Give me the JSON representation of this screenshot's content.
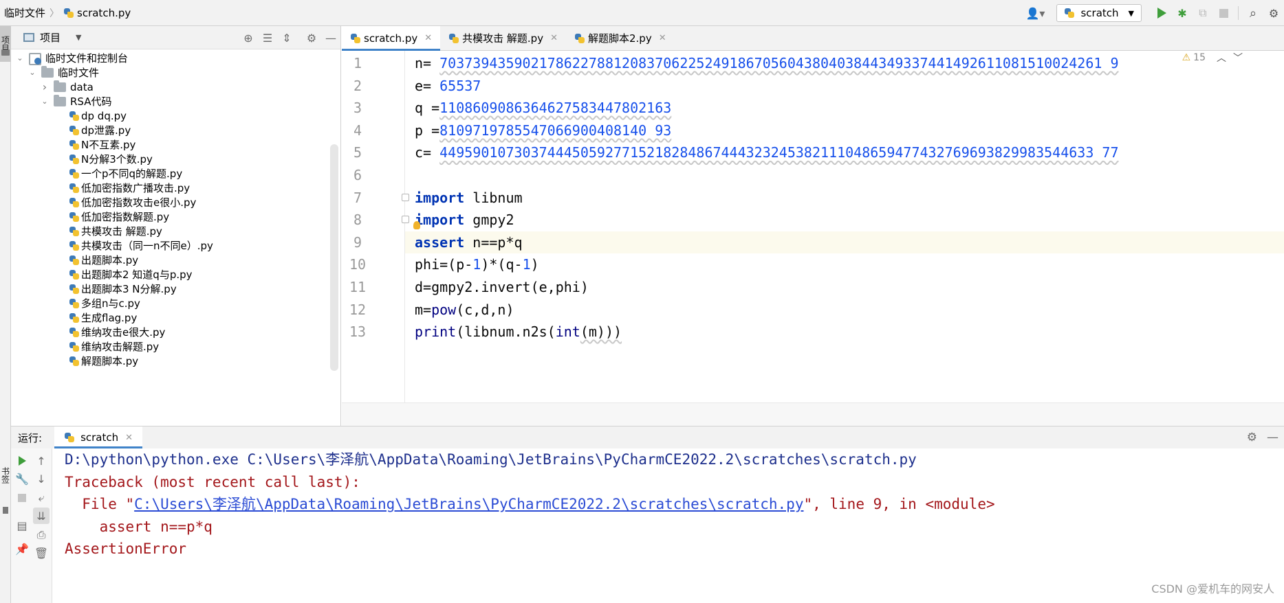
{
  "breadcrumb": {
    "root": "临时文件",
    "file": "scratch.py"
  },
  "toolbar": {
    "run_config": "scratch"
  },
  "left_strip": {
    "project_tab": "项目",
    "bookmarks_tab": "书签"
  },
  "project": {
    "title": "项目",
    "tree": [
      {
        "label": "临时文件和控制台",
        "level": 0,
        "kind": "scratch-root",
        "expanded": true
      },
      {
        "label": "临时文件",
        "level": 1,
        "kind": "folder",
        "expanded": true
      },
      {
        "label": "data",
        "level": 2,
        "kind": "folder",
        "expanded": false
      },
      {
        "label": "RSA代码",
        "level": 2,
        "kind": "folder",
        "expanded": true
      },
      {
        "label": "dp dq.py",
        "level": 3,
        "kind": "file"
      },
      {
        "label": "dp泄露.py",
        "level": 3,
        "kind": "file"
      },
      {
        "label": "N不互素.py",
        "level": 3,
        "kind": "file"
      },
      {
        "label": "N分解3个数.py",
        "level": 3,
        "kind": "file"
      },
      {
        "label": "一个p不同q的解题.py",
        "level": 3,
        "kind": "file"
      },
      {
        "label": "低加密指数广播攻击.py",
        "level": 3,
        "kind": "file"
      },
      {
        "label": "低加密指数攻击e很小.py",
        "level": 3,
        "kind": "file"
      },
      {
        "label": "低加密指数解题.py",
        "level": 3,
        "kind": "file"
      },
      {
        "label": "共模攻击 解题.py",
        "level": 3,
        "kind": "file"
      },
      {
        "label": "共模攻击（同一n不同e）.py",
        "level": 3,
        "kind": "file"
      },
      {
        "label": "出题脚本.py",
        "level": 3,
        "kind": "file"
      },
      {
        "label": "出题脚本2 知道q与p.py",
        "level": 3,
        "kind": "file"
      },
      {
        "label": "出题脚本3 N分解.py",
        "level": 3,
        "kind": "file"
      },
      {
        "label": "多组n与c.py",
        "level": 3,
        "kind": "file"
      },
      {
        "label": "生成flag.py",
        "level": 3,
        "kind": "file"
      },
      {
        "label": "维纳攻击e很大.py",
        "level": 3,
        "kind": "file"
      },
      {
        "label": "维纳攻击解题.py",
        "level": 3,
        "kind": "file"
      },
      {
        "label": "解题脚本.py",
        "level": 3,
        "kind": "file"
      }
    ]
  },
  "editor": {
    "tabs": [
      {
        "label": "scratch.py",
        "active": true
      },
      {
        "label": "共模攻击 解题.py",
        "active": false
      },
      {
        "label": "解题脚本2.py",
        "active": false
      }
    ],
    "warning_count": "15",
    "lines": [
      {
        "n": "1",
        "parts": [
          [
            "plain",
            "n= "
          ],
          [
            "num",
            "70373943590217862278812083706225249186705604380403844349337441492611081510024261 9"
          ]
        ]
      },
      {
        "n": "2",
        "parts": [
          [
            "plain",
            "e= "
          ],
          [
            "num",
            "65537"
          ]
        ]
      },
      {
        "n": "3",
        "parts": [
          [
            "plain",
            "q ="
          ],
          [
            "num",
            "1108609086364627583447802163"
          ]
        ]
      },
      {
        "n": "4",
        "parts": [
          [
            "plain",
            "p ="
          ],
          [
            "num",
            "8109719785547066900408140 93"
          ]
        ]
      },
      {
        "n": "5",
        "parts": [
          [
            "plain",
            "c= "
          ],
          [
            "num",
            "4495901073037444505927715218284867444323245382111048659477432769693829983544633 77"
          ]
        ]
      },
      {
        "n": "6",
        "parts": []
      },
      {
        "n": "7",
        "parts": [
          [
            "kw",
            "import"
          ],
          [
            "plain",
            " libnum"
          ]
        ]
      },
      {
        "n": "8",
        "parts": [
          [
            "kw",
            "import"
          ],
          [
            "plain",
            " gmpy2"
          ]
        ]
      },
      {
        "n": "9",
        "parts": [
          [
            "kw",
            "assert"
          ],
          [
            "plain",
            " n==p*q"
          ]
        ]
      },
      {
        "n": "10",
        "parts": [
          [
            "plain",
            "phi=(p-"
          ],
          [
            "num",
            "1"
          ],
          [
            "plain",
            ")*(q-"
          ],
          [
            "num",
            "1"
          ],
          [
            "plain",
            ")"
          ]
        ]
      },
      {
        "n": "11",
        "parts": [
          [
            "plain",
            "d=gmpy2.invert(e,phi)"
          ]
        ]
      },
      {
        "n": "12",
        "parts": [
          [
            "plain",
            "m="
          ],
          [
            "fn",
            "pow"
          ],
          [
            "plain",
            "(c,d,n)"
          ]
        ]
      },
      {
        "n": "13",
        "parts": [
          [
            "fn",
            "print"
          ],
          [
            "plain",
            "(libnum.n2s("
          ],
          [
            "fn",
            "int"
          ],
          [
            "plain",
            "(m)))"
          ]
        ]
      }
    ]
  },
  "run": {
    "label": "运行:",
    "tab": "scratch",
    "output": [
      {
        "cls": "cmd",
        "text": "D:\\python\\python.exe C:\\Users\\李泽航\\AppData\\Roaming\\JetBrains\\PyCharmCE2022.2\\scratches\\scratch.py"
      },
      {
        "cls": "err",
        "text": "Traceback (most recent call last):"
      },
      {
        "cls": "err",
        "prefix": "  File \"",
        "link": "C:\\Users\\李泽航\\AppData\\Roaming\\JetBrains\\PyCharmCE2022.2\\scratches\\scratch.py",
        "suffix": "\", line 9, in <module>"
      },
      {
        "cls": "err",
        "text": "    assert n==p*q"
      },
      {
        "cls": "err",
        "text": "AssertionError"
      }
    ]
  },
  "watermark": "CSDN @爱机车的网安人"
}
